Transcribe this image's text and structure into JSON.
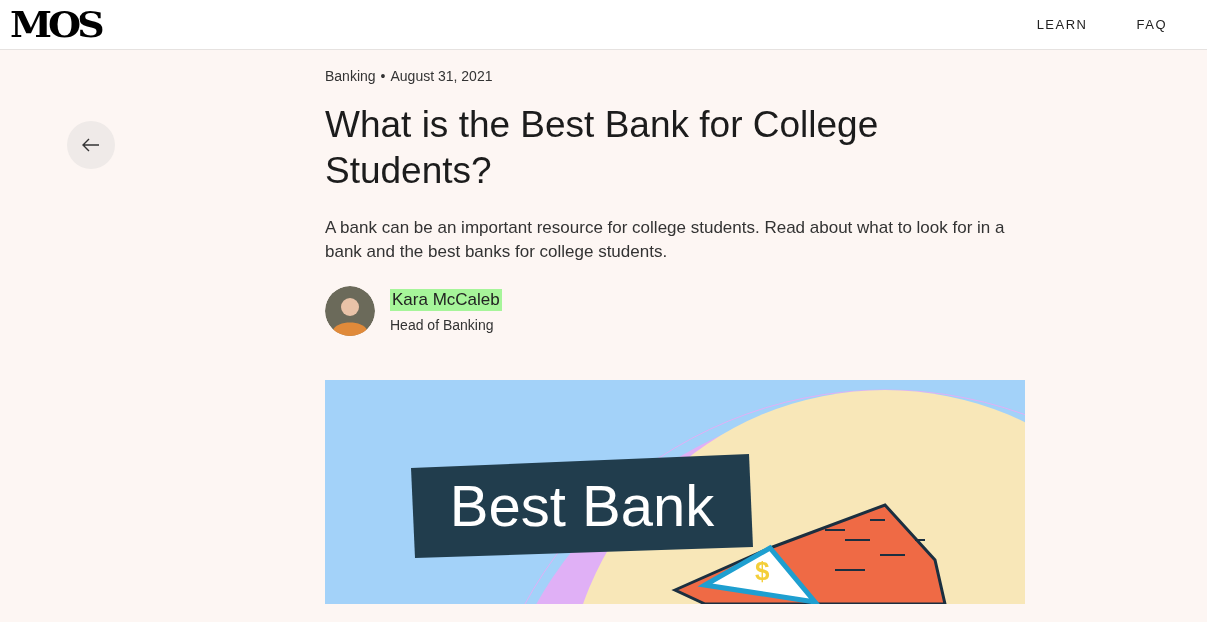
{
  "header": {
    "logo": "MOS",
    "nav": [
      {
        "label": "LEARN"
      },
      {
        "label": "FAQ"
      }
    ]
  },
  "article": {
    "category": "Banking",
    "separator": "•",
    "date": "August 31, 2021",
    "title": "What is the Best Bank for College Students?",
    "summary": "A bank can be an important resource for college students. Read about what to look for in a bank and the best banks for college students.",
    "author": {
      "name": "Kara McCaleb",
      "highlighted": true,
      "role": "Head of Banking"
    },
    "hero": {
      "label": "Best Bank",
      "sign": "$"
    }
  }
}
